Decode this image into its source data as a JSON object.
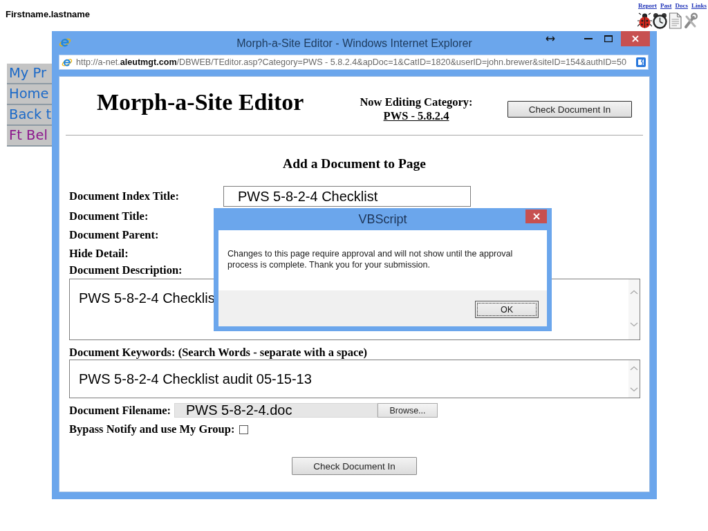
{
  "page": {
    "user": "Firstname.lastname",
    "top_links": [
      "Report",
      "Past",
      "Docs",
      "Links"
    ]
  },
  "sidebar": {
    "items": [
      {
        "label": "My Pr",
        "visited": false
      },
      {
        "label": "Home",
        "visited": false
      },
      {
        "label": "Back t",
        "visited": false
      },
      {
        "label": "Ft Bel",
        "visited": true
      }
    ]
  },
  "browser": {
    "title": "Morph-a-Site Editor - Windows Internet Explorer",
    "address": "http://a-net.**aleutmgt.com**/DBWEB/TEditor.asp?Category=PWS - 5.8.2.4&apDoc=1&CatID=1820&userID=john.brewer&siteID=154&authID=50"
  },
  "editor": {
    "heading": "Morph-a-Site Editor",
    "category_label": "Now Editing Category:",
    "category": "PWS - 5.8.2.4",
    "top_button": "Check Document In",
    "section_title": "Add a Document to Page",
    "fields": [
      {
        "kind": "text",
        "label": "Document Index Title:",
        "value": "PWS 5-8-2-4 Checklist"
      },
      {
        "kind": "label",
        "label": "Document Title:"
      },
      {
        "kind": "label",
        "label": "Document Parent:"
      },
      {
        "kind": "label",
        "label": "Hide Detail:"
      },
      {
        "kind": "textarea",
        "label": "Document Description:",
        "value": "PWS 5-8-2-4 Checklis"
      },
      {
        "kind": "textarea",
        "label": "Document Keywords: (Search Words - separate with a space)",
        "value": "PWS 5-8-2-4 Checklist audit 05-15-13"
      },
      {
        "kind": "file",
        "label": "Document Filename:",
        "value": "PWS 5-8-2-4.doc",
        "button": "Browse..."
      },
      {
        "kind": "checkbox",
        "label": "Bypass Notify and use My Group:",
        "checked": false
      }
    ],
    "submit_button": "Check Document In"
  },
  "dialog": {
    "title": "VBScript",
    "message": "Changes to this page require approval and will not show until the approval process is complete. Thank you for your submission.",
    "button": "OK"
  }
}
